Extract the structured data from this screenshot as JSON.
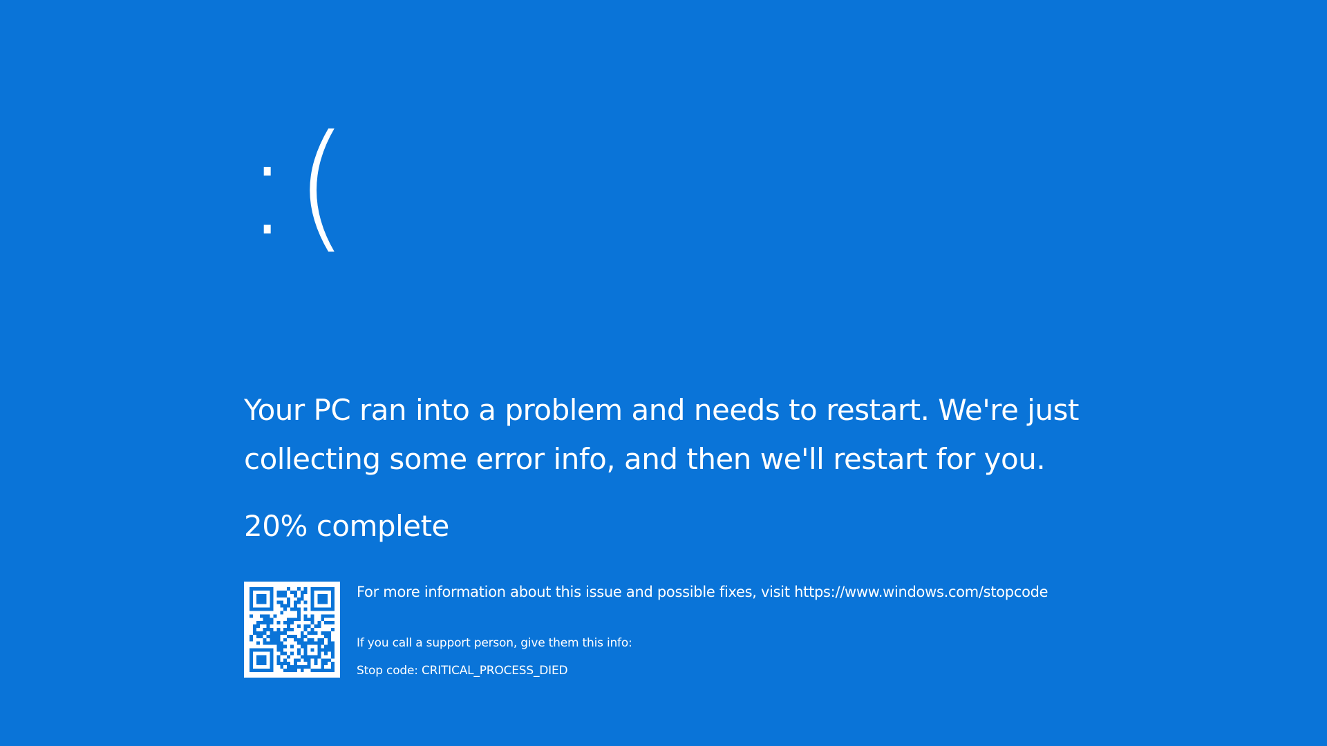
{
  "screen": {
    "background_color": "#0a74d8",
    "text_color": "#ffffff"
  },
  "sad_face": {
    "glyph": ":(",
    "icon_name": "sad-face-emoticon"
  },
  "message": {
    "text": "Your PC ran into a problem and needs to restart. We're just collecting some error info, and then we'll restart for you."
  },
  "progress": {
    "percent": 20,
    "label": "20% complete"
  },
  "info": {
    "qr_icon_name": "qr-code-icon",
    "more_info_text": "For more information about this issue and possible fixes, visit https://www.windows.com/stopcode",
    "support_text": "If you call a support person, give them this info:",
    "stop_code_text": "Stop code: CRITICAL_PROCESS_DIED"
  }
}
